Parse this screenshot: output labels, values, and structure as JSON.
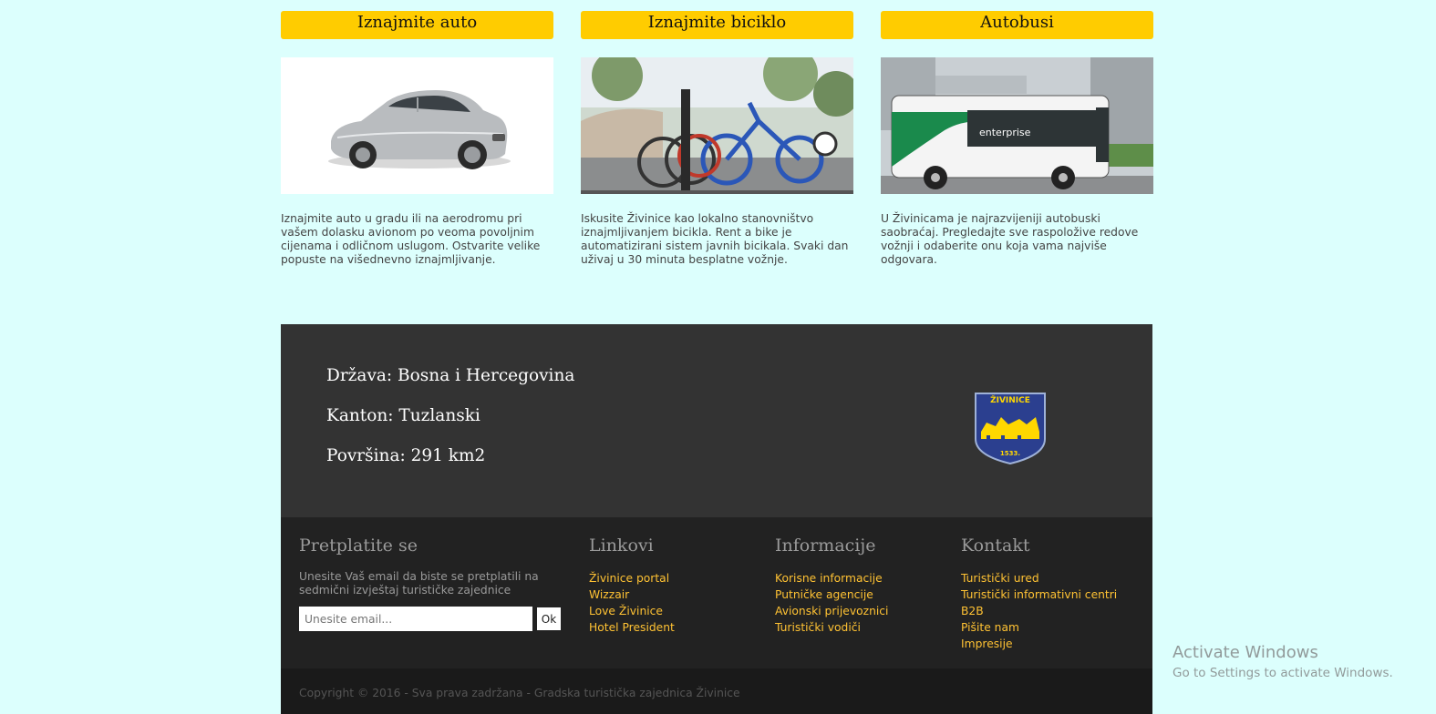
{
  "services": [
    {
      "title": "Iznajmite auto",
      "image": "silver-sedan-car",
      "description": "Iznajmite auto u gradu ili na aerodromu pri vašem dolasku avionom po veoma povoljnim cijenama i odličnom uslugom. Ostvarite velike popuste na višednevno iznajmljivanje."
    },
    {
      "title": "Iznajmite biciklo",
      "image": "bicycle-rack-photo",
      "description": "Iskusite Živinice kao lokalno stanovništvo iznajmljivanjem bicikla. Rent a bike je automatizirani sistem javnih bicikala. Svaki dan uživaj u 30 minuta besplatne vožnje."
    },
    {
      "title": "Autobusi",
      "image": "city-bus-photo",
      "description": "U Živinicama je najrazvijeniji autobuski saobraćaj. Pregledajte sve raspoložive redove vožnji i odaberite onu koja vama najviše odgovara."
    }
  ],
  "info": {
    "country": "Država: Bosna i Hercegovina",
    "canton": "Kanton: Tuzlanski",
    "area": "Površina: 291 km2",
    "crest_label": "ŽIVINICE",
    "crest_year": "1533."
  },
  "footer": {
    "subscribe": {
      "title": "Pretplatite se",
      "text": "Unesite Vaš email da biste se pretplatili na sedmični izvještaj turističke zajednice",
      "placeholder": "Unesite email...",
      "button": "Ok"
    },
    "links": {
      "title": "Linkovi",
      "items": [
        "Živinice portal",
        "Wizzair",
        "Love Živinice",
        "Hotel President"
      ]
    },
    "information": {
      "title": "Informacije",
      "items": [
        "Korisne informacije",
        "Putničke agencije",
        "Avionski prijevoznici",
        "Turistički vodiči"
      ]
    },
    "contact": {
      "title": "Kontakt",
      "items": [
        "Turistički ured",
        "Turistički informativni centri",
        "B2B",
        "Pišite nam",
        "Impresije"
      ]
    },
    "copyright": "Copyright © 2016 - Sva prava zadržana - Gradska turistička zajednica Živinice"
  },
  "watermark": {
    "title": "Activate Windows",
    "subtitle": "Go to Settings to activate Windows."
  },
  "colors": {
    "page_bg": "#dcfffd",
    "accent_yellow": "#ffcc00",
    "info_bg": "#333333",
    "footer_bg": "#222222",
    "link": "#ffc233"
  }
}
